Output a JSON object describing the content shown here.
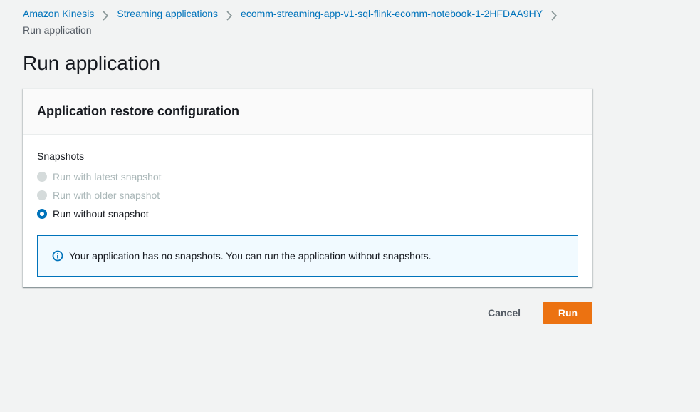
{
  "breadcrumb": {
    "items": [
      {
        "label": "Amazon Kinesis"
      },
      {
        "label": "Streaming applications"
      },
      {
        "label": "ecomm-streaming-app-v1-sql-flink-ecomm-notebook-1-2HFDAA9HY"
      }
    ],
    "current": "Run application"
  },
  "page": {
    "title": "Run application"
  },
  "panel": {
    "title": "Application restore configuration",
    "field_label": "Snapshots",
    "options": [
      {
        "label": "Run with latest snapshot",
        "state": "disabled"
      },
      {
        "label": "Run with older snapshot",
        "state": "disabled"
      },
      {
        "label": "Run without snapshot",
        "state": "selected"
      }
    ],
    "info_message": "Your application has no snapshots. You can run the application without snapshots."
  },
  "actions": {
    "cancel_label": "Cancel",
    "run_label": "Run"
  },
  "colors": {
    "link": "#0073bb",
    "primary_button": "#ec7211",
    "info_border": "#0073bb",
    "info_background": "#f1faff",
    "page_background": "#f2f3f3"
  },
  "icons": {
    "separator": "chevron-right-icon",
    "info": "info-icon"
  }
}
